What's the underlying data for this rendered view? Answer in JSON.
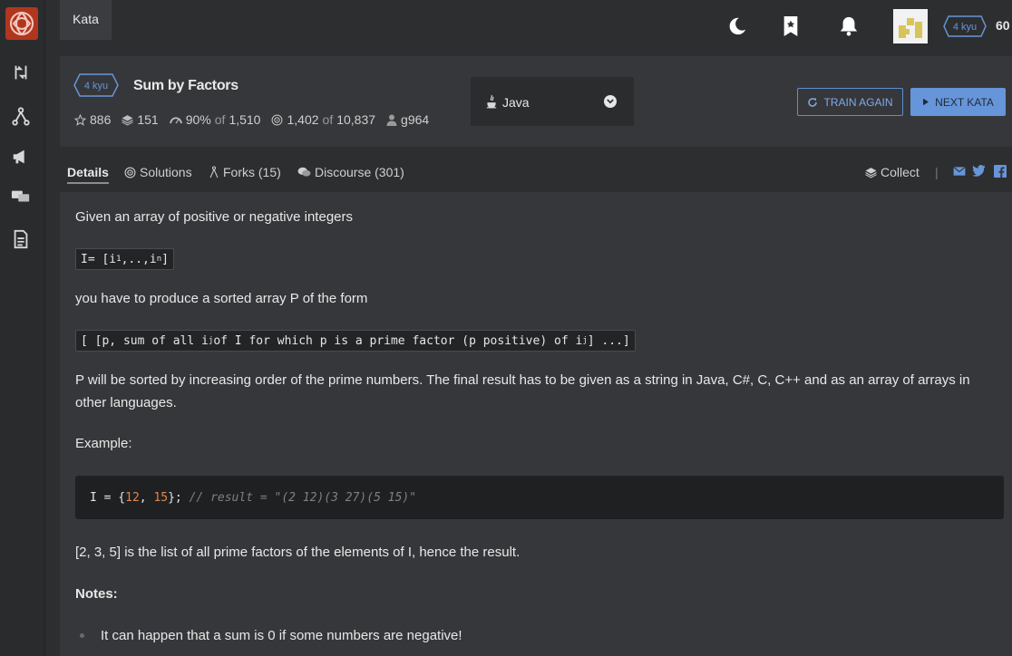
{
  "sidebar": {
    "items": [
      {
        "name": "practice-icon"
      },
      {
        "name": "kumite-icon"
      },
      {
        "name": "announcements-icon"
      },
      {
        "name": "discussions-icon"
      },
      {
        "name": "docs-icon"
      }
    ]
  },
  "topbar": {
    "tab_label": "Kata",
    "rank_label": "4 kyu",
    "honor": "60"
  },
  "kata": {
    "rank_label": "4 kyu",
    "title": "Sum by Factors",
    "stars": "886",
    "collections": "151",
    "satisfaction": "90%",
    "satisfaction_of_label": "of",
    "votes": "1,510",
    "completed": "1,402",
    "completed_of_label": "of",
    "attempts": "10,837",
    "author": "g964"
  },
  "language": {
    "selected": "Java"
  },
  "actions": {
    "train_again": "TRAIN AGAIN",
    "next_kata": "NEXT KATA"
  },
  "tabs": {
    "details": "Details",
    "solutions": "Solutions",
    "forks": "Forks (15)",
    "discourse": "Discourse (301)",
    "collect": "Collect",
    "separator": "|"
  },
  "description": {
    "intro": "Given an array of positive or negative integers",
    "array_def": "I= [i",
    "array_def_sub1": "1",
    "array_def_mid": ",..,i",
    "array_def_sub2": "n",
    "array_def_end": "]",
    "produce": "you have to produce a sorted array P of the form",
    "form_start": "[ [p, sum of all i",
    "form_sub1": "j",
    "form_mid": " of I for which p is a prime factor (p positive) of i",
    "form_sub2": "j",
    "form_end": "] ...]",
    "sorted_line1": "P will be sorted by increasing order of the prime numbers. The final result has to be given as a string in Java, C#, C, C++ and as an array of arrays in",
    "sorted_line2": "other languages.",
    "example_label": "Example:",
    "code_prefix": "I = {",
    "code_num1": "12",
    "code_comma": ", ",
    "code_num2": "15",
    "code_suffix": "}; ",
    "code_comment": "// result = \"(2 12)(3 27)(5 15)\"",
    "explanation": "[2, 3, 5] is the list of all prime factors of the elements of I, hence the result.",
    "notes_label": "Notes:",
    "note1": "It can happen that a sum is 0 if some numbers are negative!"
  },
  "colors": {
    "accent_blue": "#6795d9",
    "logo_red": "#b1361e",
    "code_number": "#e0874d"
  }
}
